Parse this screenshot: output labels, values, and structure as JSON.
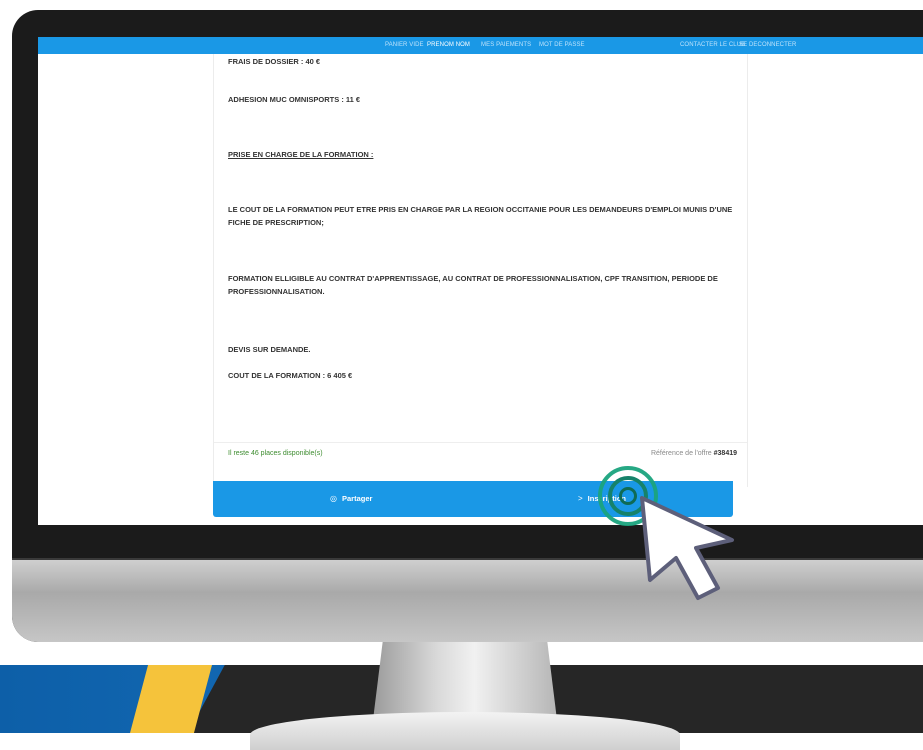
{
  "nav": {
    "panier": "PANIER VIDE",
    "user": "PRENOM NOM",
    "paiements": "MES PAIEMENTS",
    "motdepasse": "MOT DE PASSE",
    "contact": "CONTACTER LE CLUB",
    "logout": "SE DECONNECTER"
  },
  "content": {
    "frais": "FRAIS DE DOSSIER : 40 €",
    "adhesion": "ADHESION MUC OMNISPORTS : 11 €",
    "prise_heading": "PRISE EN CHARGE DE LA FORMATION :",
    "region": "LE COUT DE LA FORMATION PEUT ETRE PRIS EN CHARGE PAR LA REGION OCCITANIE POUR LES DEMANDEURS D'EMPLOI MUNIS D'UNE FICHE DE PRESCRIPTION;",
    "eligible": "FORMATION ELLIGIBLE AU CONTRAT D'APPRENTISSAGE, AU CONTRAT DE PROFESSIONNALISATION, CPF TRANSITION, PERIODE DE PROFESSIONNALISATION.",
    "devis": "DEVIS SUR DEMANDE.",
    "cout": "COUT DE LA FORMATION : 6 405 €"
  },
  "footer": {
    "places": "Il reste 46 places disponible(s)",
    "ref_label": "Référence de l'offre",
    "ref_number": "#38419"
  },
  "actions": {
    "share_icon": "share-icon",
    "share": "Partager",
    "inscription_icon": "chevron-right-icon",
    "inscription": "Inscription"
  },
  "colors": {
    "accent": "#1a98e6",
    "available": "#3d8c2f",
    "ripple": "#1aa37d",
    "stripe_blue": "#0d5fa8",
    "stripe_yellow": "#f5c33b"
  }
}
